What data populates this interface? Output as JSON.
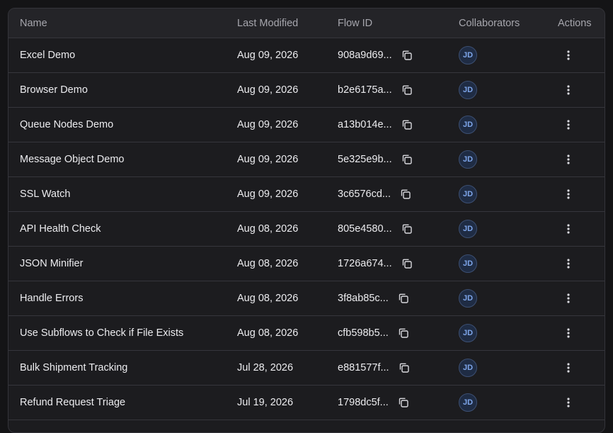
{
  "table": {
    "columns": {
      "name": "Name",
      "modified": "Last Modified",
      "flow_id": "Flow ID",
      "collaborators": "Collaborators",
      "actions": "Actions"
    },
    "rows": [
      {
        "name": "Excel Demo",
        "modified": "Aug 09, 2026",
        "flow_id": "908a9d69...",
        "collaborator": "JD"
      },
      {
        "name": "Browser Demo",
        "modified": "Aug 09, 2026",
        "flow_id": "b2e6175a...",
        "collaborator": "JD"
      },
      {
        "name": "Queue Nodes Demo",
        "modified": "Aug 09, 2026",
        "flow_id": "a13b014e...",
        "collaborator": "JD"
      },
      {
        "name": "Message Object Demo",
        "modified": "Aug 09, 2026",
        "flow_id": "5e325e9b...",
        "collaborator": "JD"
      },
      {
        "name": "SSL Watch",
        "modified": "Aug 09, 2026",
        "flow_id": "3c6576cd...",
        "collaborator": "JD"
      },
      {
        "name": "API Health Check",
        "modified": "Aug 08, 2026",
        "flow_id": "805e4580...",
        "collaborator": "JD"
      },
      {
        "name": "JSON Minifier",
        "modified": "Aug 08, 2026",
        "flow_id": "1726a674...",
        "collaborator": "JD"
      },
      {
        "name": "Handle Errors",
        "modified": "Aug 08, 2026",
        "flow_id": "3f8ab85c...",
        "collaborator": "JD"
      },
      {
        "name": "Use Subflows to Check if File Exists",
        "modified": "Aug 08, 2026",
        "flow_id": "cfb598b5...",
        "collaborator": "JD"
      },
      {
        "name": "Bulk Shipment Tracking",
        "modified": "Jul 28, 2026",
        "flow_id": "e881577f...",
        "collaborator": "JD"
      },
      {
        "name": "Refund Request Triage",
        "modified": "Jul 19, 2026",
        "flow_id": "1798dc5f...",
        "collaborator": "JD"
      }
    ]
  },
  "icons": {
    "copy": "copy-icon",
    "actions": "more-vertical-icon"
  },
  "colors": {
    "background": "#1c1c1f",
    "header": "#242428",
    "avatar_text": "#7ea6ea"
  }
}
